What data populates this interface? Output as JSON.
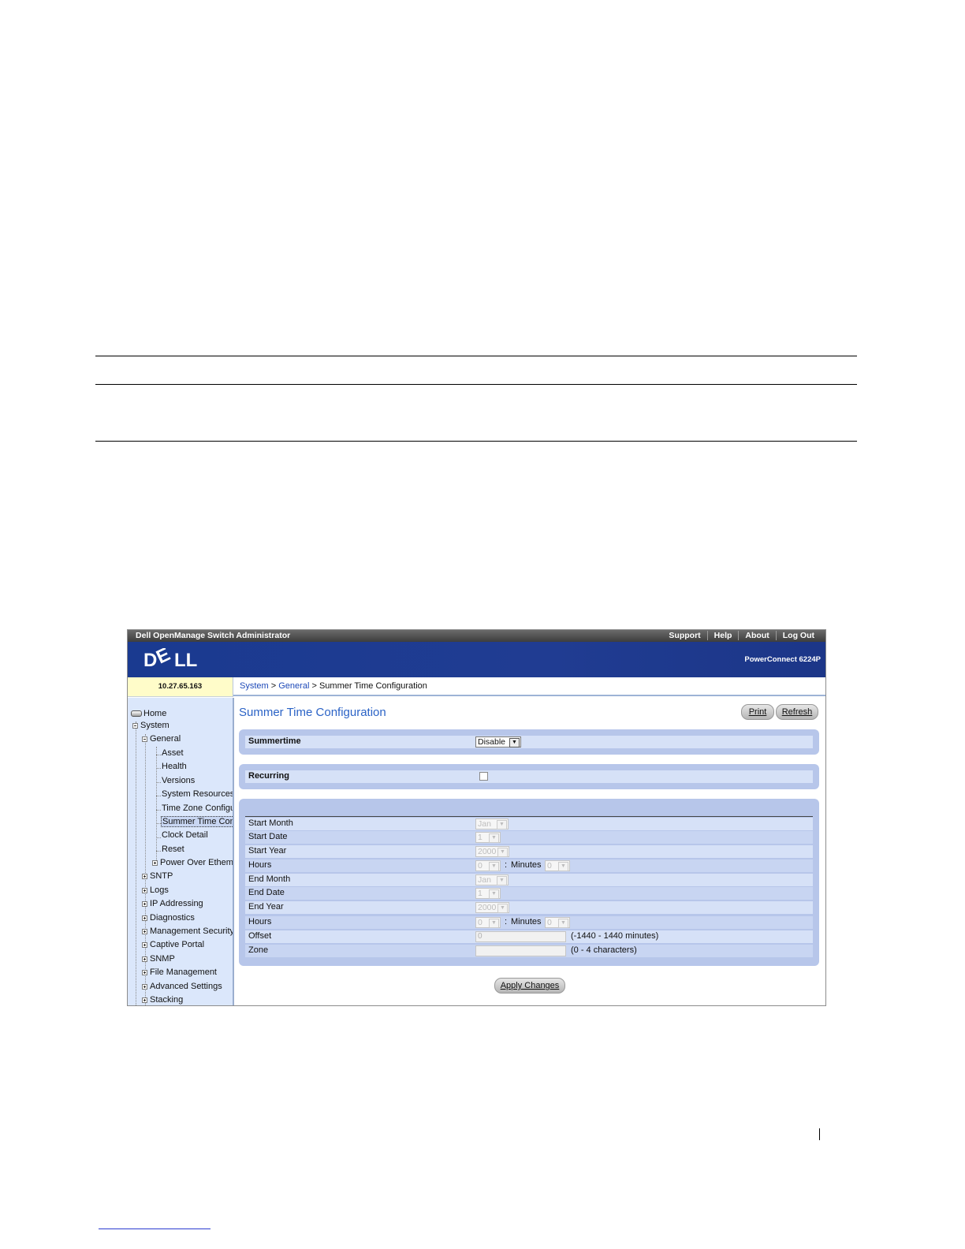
{
  "window": {
    "app_title": "Dell OpenManage Switch Administrator",
    "top_links": [
      "Support",
      "Help",
      "About",
      "Log Out"
    ],
    "logo_text": "DELL",
    "product": "PowerConnect 6224P",
    "ip": "10.27.65.163"
  },
  "breadcrumb": {
    "system": "System",
    "general": "General",
    "current": "Summer Time Configuration",
    "sep": ">"
  },
  "nav": {
    "home": "Home",
    "system": "System",
    "general": "General",
    "asset": "Asset",
    "health": "Health",
    "versions": "Versions",
    "system_resources": "System Resources",
    "time_zone": "Time Zone Configura",
    "summer_time": "Summer Time Confi",
    "clock_detail": "Clock Detail",
    "reset": "Reset",
    "poe": "Power Over Etheme",
    "sntp": "SNTP",
    "logs": "Logs",
    "ip_addressing": "IP Addressing",
    "diagnostics": "Diagnostics",
    "management_security": "Management Security",
    "captive_portal": "Captive Portal",
    "snmp": "SNMP",
    "file_management": "File Management",
    "advanced_settings": "Advanced Settings",
    "stacking": "Stacking"
  },
  "content": {
    "title": "Summer Time Configuration",
    "print_label": "Print",
    "refresh_label": "Refresh",
    "summertime_label": "Summertime",
    "summertime_value": "Disable",
    "recurring_label": "Recurring",
    "recurring_checked": false,
    "start_month_label": "Start Month",
    "start_month_value": "Jan",
    "start_date_label": "Start Date",
    "start_date_value": "1",
    "start_year_label": "Start Year",
    "start_year_value": "2000",
    "start_hours_label": "Hours",
    "start_hours_value": "0",
    "colon": ":",
    "start_minutes_label": "Minutes",
    "start_minutes_value": "0",
    "end_month_label": "End Month",
    "end_month_value": "Jan",
    "end_date_label": "End Date",
    "end_date_value": "1",
    "end_year_label": "End Year",
    "end_year_value": "2000",
    "end_hours_label": "Hours",
    "end_hours_value": "0",
    "end_minutes_label": "Minutes",
    "end_minutes_value": "0",
    "offset_label": "Offset",
    "offset_value": "0",
    "offset_hint": "(-1440 - 1440 minutes)",
    "zone_label": "Zone",
    "zone_value": "",
    "zone_hint": "(0 - 4 characters)",
    "apply_label": "Apply Changes"
  }
}
